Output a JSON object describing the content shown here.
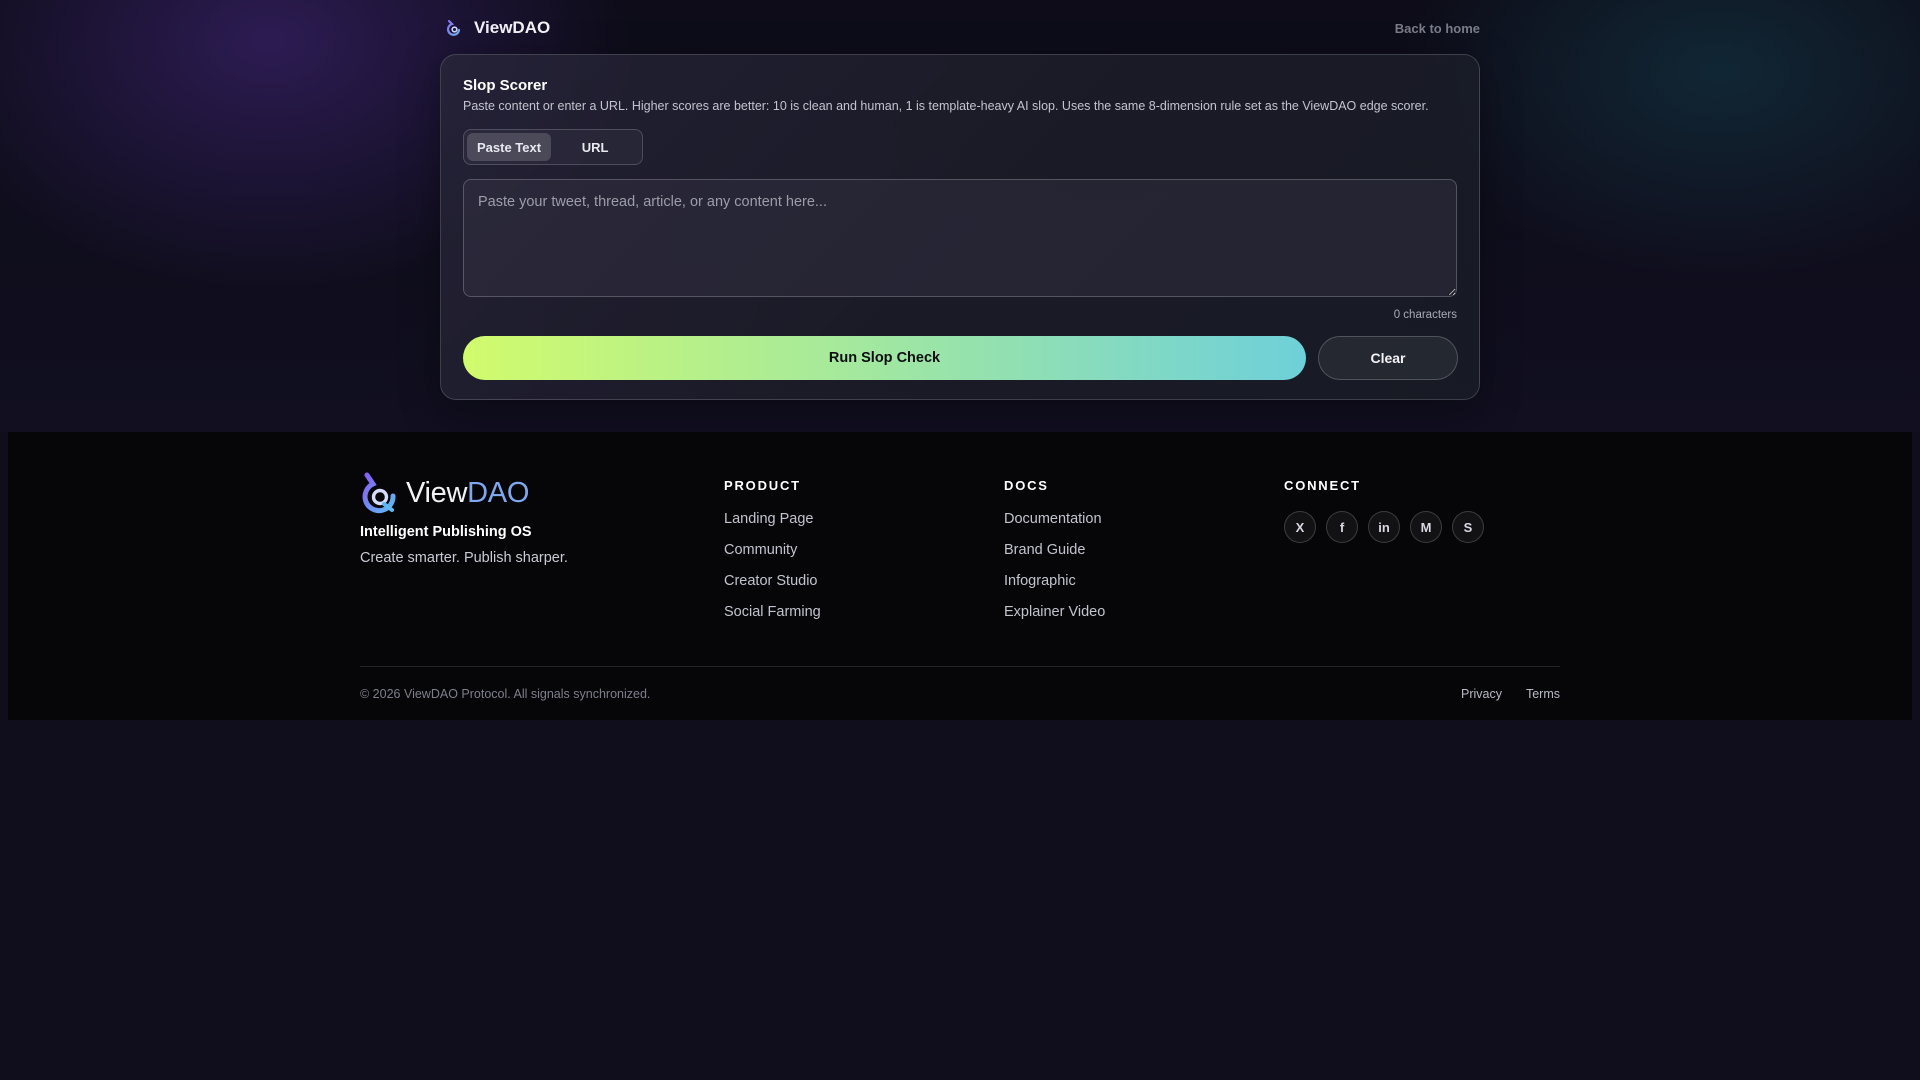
{
  "header": {
    "brand": "ViewDAO",
    "back_link": "Back to home"
  },
  "scorer": {
    "title": "Slop Scorer",
    "description": "Paste content or enter a URL. Higher scores are better: 10 is clean and human, 1 is template-heavy AI slop. Uses the same 8-dimension rule set as the ViewDAO edge scorer.",
    "tabs": [
      {
        "label": "Paste Text",
        "active": true
      },
      {
        "label": "URL",
        "active": false
      }
    ],
    "input": {
      "value": "",
      "placeholder": "Paste your tweet, thread, article, or any content here..."
    },
    "char_count": "0 characters",
    "run_label": "Run Slop Check",
    "clear_label": "Clear"
  },
  "footer": {
    "brand": {
      "name_part1": "View",
      "name_part2": "DAO"
    },
    "tagline": "Intelligent Publishing OS",
    "subline": "Create smarter. Publish sharper.",
    "columns": [
      {
        "heading": "PRODUCT",
        "links": [
          "Landing Page",
          "Community",
          "Creator Studio",
          "Social Farming"
        ]
      },
      {
        "heading": "DOCS",
        "links": [
          "Documentation",
          "Brand Guide",
          "Infographic",
          "Explainer Video"
        ]
      },
      {
        "heading": "CONNECT"
      }
    ],
    "socials": [
      {
        "label": "X",
        "icon": "x-icon"
      },
      {
        "label": "f",
        "icon": "facebook-icon"
      },
      {
        "label": "in",
        "icon": "linkedin-icon"
      },
      {
        "label": "M",
        "icon": "medium-icon"
      },
      {
        "label": "S",
        "icon": "substack-icon"
      }
    ],
    "copyright": "© 2026 ViewDAO Protocol. All signals synchronized.",
    "legal": [
      "Privacy",
      "Terms"
    ]
  },
  "colors": {
    "accent_gradient_start": "#d2fb6c",
    "accent_gradient_end": "#6ed0d9",
    "logo_blue": "#7fa7f0",
    "background": "#100e1c"
  }
}
